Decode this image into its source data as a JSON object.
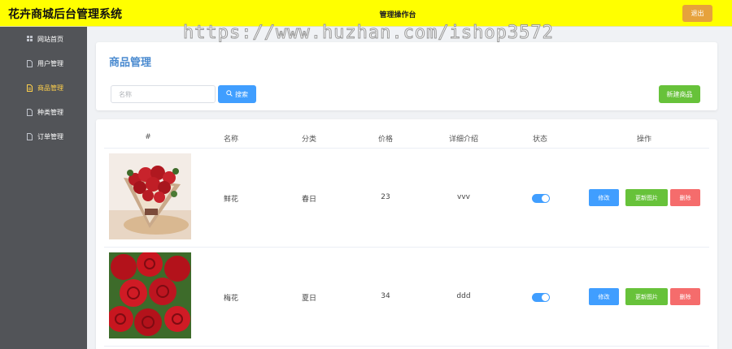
{
  "header": {
    "app_title": "花卉商城后台管理系统",
    "center_title": "管理操作台",
    "logout_label": "退出"
  },
  "sidebar": {
    "items": [
      {
        "label": "网站首页",
        "icon": "grid-icon",
        "active": false
      },
      {
        "label": "用户管理",
        "icon": "document-icon",
        "active": false
      },
      {
        "label": "商品管理",
        "icon": "document-icon",
        "active": true
      },
      {
        "label": "种类管理",
        "icon": "document-icon",
        "active": false
      },
      {
        "label": "订单管理",
        "icon": "document-icon",
        "active": false
      }
    ]
  },
  "watermark": "https://www.huzhan.com/ishop3572",
  "main": {
    "title": "商品管理",
    "search": {
      "placeholder": "名称",
      "value": "",
      "button_label": "搜索"
    },
    "new_button_label": "新建商品"
  },
  "table": {
    "headers": [
      "#",
      "名称",
      "分类",
      "价格",
      "详细介绍",
      "状态",
      "操作"
    ],
    "rows": [
      {
        "name": "鲜花",
        "category": "春日",
        "price": "23",
        "description": "vvv",
        "status_on": true,
        "image": "bouquet-photo"
      },
      {
        "name": "梅花",
        "category": "夏日",
        "price": "34",
        "description": "ddd",
        "status_on": true,
        "image": "red-roses-photo"
      }
    ],
    "actions": {
      "edit": "修改",
      "update_image": "更新图片",
      "delete": "删除"
    }
  },
  "colors": {
    "header_bg": "#ffff00",
    "sidebar_bg": "#525458",
    "sidebar_active": "#ffd04b",
    "primary": "#409eff",
    "success": "#67c23a",
    "danger": "#f56c6c",
    "warning": "#e6a23c",
    "title_blue": "#4b8bd0"
  }
}
